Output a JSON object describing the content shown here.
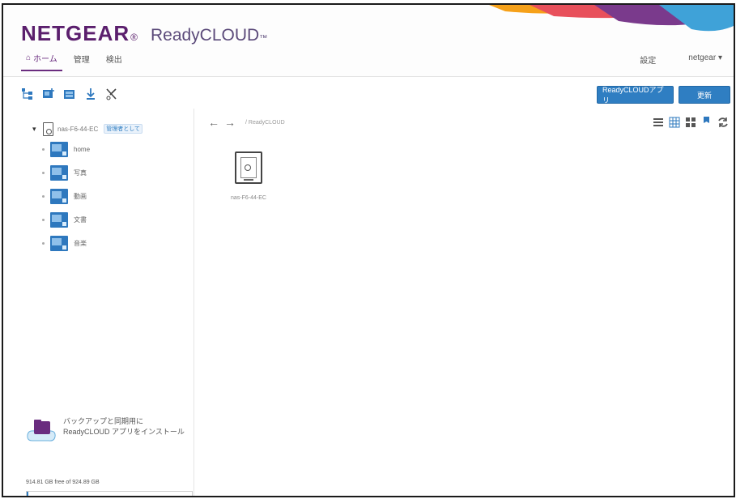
{
  "header": {
    "brand": "NETGEAR",
    "brand_mark": "®",
    "product": "ReadyCLOUD",
    "product_tm": "™",
    "nav": [
      {
        "label": "ホーム",
        "active": true
      },
      {
        "label": "管理",
        "active": false
      },
      {
        "label": "検出",
        "active": false
      }
    ],
    "settings_label": "設定",
    "user_label": "netgear ▾"
  },
  "toolbar": {
    "tools": [
      "tree-icon",
      "new-folder-icon",
      "share-icon",
      "download-icon",
      "cut-icon"
    ]
  },
  "actions": {
    "primary_label": "ReadyCLOUDアプリ",
    "secondary_label": "更新"
  },
  "tree": {
    "root_label": "nas-F6-44-EC",
    "root_badge": "管理者として",
    "items": [
      {
        "label": "home"
      },
      {
        "label": "写真"
      },
      {
        "label": "動画"
      },
      {
        "label": "文書"
      },
      {
        "label": "音楽"
      }
    ]
  },
  "promo": {
    "text": "バックアップと同期用に ReadyCLOUD アプリをインストール"
  },
  "storage": {
    "text": "914.81 GB free of 924.89 GB",
    "used_fraction": 0.011
  },
  "main": {
    "path": "/ ReadyCLOUD",
    "device_label": "nas-F6-44-EC"
  },
  "colors": {
    "brand_purple": "#5b1f6d",
    "accent_blue": "#2f7ec2"
  }
}
